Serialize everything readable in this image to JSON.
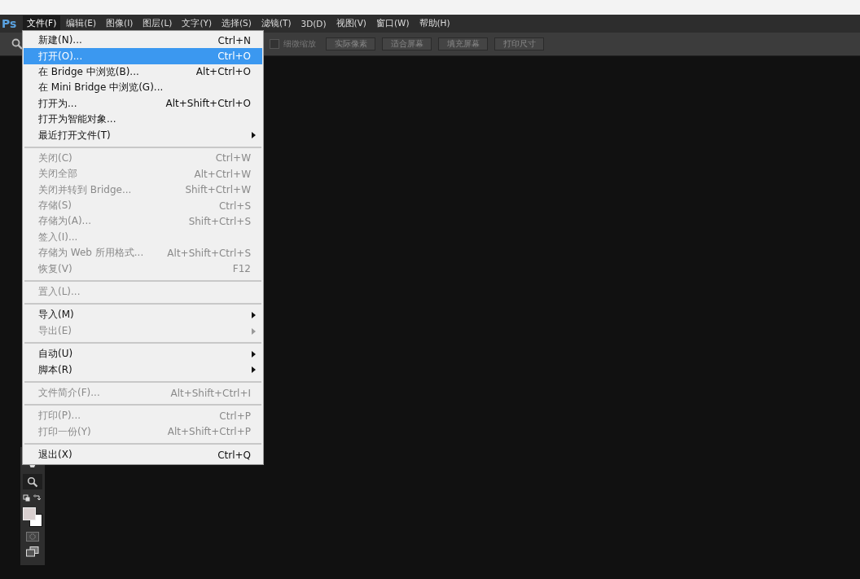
{
  "app_logo": "Ps",
  "menubar": [
    {
      "label": "文件(F)",
      "selected": true
    },
    {
      "label": "编辑(E)",
      "selected": false
    },
    {
      "label": "图像(I)",
      "selected": false
    },
    {
      "label": "图层(L)",
      "selected": false
    },
    {
      "label": "文字(Y)",
      "selected": false
    },
    {
      "label": "选择(S)",
      "selected": false
    },
    {
      "label": "滤镜(T)",
      "selected": false
    },
    {
      "label": "3D(D)",
      "selected": false
    },
    {
      "label": "视图(V)",
      "selected": false
    },
    {
      "label": "窗口(W)",
      "selected": false
    },
    {
      "label": "帮助(H)",
      "selected": false
    }
  ],
  "options_bar": {
    "checkbox": {
      "label": "细微缩放",
      "checked": false
    },
    "buttons": [
      "实际像素",
      "适合屏幕",
      "填充屏幕",
      "打印尺寸"
    ]
  },
  "file_menu": [
    [
      {
        "label": "新建(N)...",
        "shortcut": "Ctrl+N",
        "selected": false,
        "disabled": false,
        "submenu": false
      },
      {
        "label": "打开(O)...",
        "shortcut": "Ctrl+O",
        "selected": true,
        "disabled": false,
        "submenu": false
      },
      {
        "label": "在 Bridge 中浏览(B)...",
        "shortcut": "Alt+Ctrl+O",
        "selected": false,
        "disabled": false,
        "submenu": false
      },
      {
        "label": "在 Mini Bridge 中浏览(G)...",
        "selected": false,
        "disabled": false,
        "submenu": false
      },
      {
        "label": "打开为...",
        "shortcut": "Alt+Shift+Ctrl+O",
        "selected": false,
        "disabled": false,
        "submenu": false
      },
      {
        "label": "打开为智能对象...",
        "selected": false,
        "disabled": false,
        "submenu": false
      },
      {
        "label": "最近打开文件(T)",
        "selected": false,
        "disabled": false,
        "submenu": true
      }
    ],
    [
      {
        "label": "关闭(C)",
        "shortcut": "Ctrl+W",
        "selected": false,
        "disabled": true,
        "submenu": false
      },
      {
        "label": "关闭全部",
        "shortcut": "Alt+Ctrl+W",
        "selected": false,
        "disabled": true,
        "submenu": false
      },
      {
        "label": "关闭并转到 Bridge...",
        "shortcut": "Shift+Ctrl+W",
        "selected": false,
        "disabled": true,
        "submenu": false
      },
      {
        "label": "存储(S)",
        "shortcut": "Ctrl+S",
        "selected": false,
        "disabled": true,
        "submenu": false
      },
      {
        "label": "存储为(A)...",
        "shortcut": "Shift+Ctrl+S",
        "selected": false,
        "disabled": true,
        "submenu": false
      },
      {
        "label": "签入(I)...",
        "selected": false,
        "disabled": true,
        "submenu": false
      },
      {
        "label": "存储为 Web 所用格式...",
        "shortcut": "Alt+Shift+Ctrl+S",
        "selected": false,
        "disabled": true,
        "submenu": false
      },
      {
        "label": "恢复(V)",
        "shortcut": "F12",
        "selected": false,
        "disabled": true,
        "submenu": false
      }
    ],
    [
      {
        "label": "置入(L)...",
        "selected": false,
        "disabled": true,
        "submenu": false
      }
    ],
    [
      {
        "label": "导入(M)",
        "selected": false,
        "disabled": false,
        "submenu": true
      },
      {
        "label": "导出(E)",
        "selected": false,
        "disabled": true,
        "submenu": true
      }
    ],
    [
      {
        "label": "自动(U)",
        "selected": false,
        "disabled": false,
        "submenu": true
      },
      {
        "label": "脚本(R)",
        "selected": false,
        "disabled": false,
        "submenu": true
      }
    ],
    [
      {
        "label": "文件简介(F)...",
        "shortcut": "Alt+Shift+Ctrl+I",
        "selected": false,
        "disabled": true,
        "submenu": false
      }
    ],
    [
      {
        "label": "打印(P)...",
        "shortcut": "Ctrl+P",
        "selected": false,
        "disabled": true,
        "submenu": false
      },
      {
        "label": "打印一份(Y)",
        "shortcut": "Alt+Shift+Ctrl+P",
        "selected": false,
        "disabled": true,
        "submenu": false
      }
    ],
    [
      {
        "label": "退出(X)",
        "shortcut": "Ctrl+Q",
        "selected": false,
        "disabled": false,
        "submenu": false
      }
    ]
  ]
}
